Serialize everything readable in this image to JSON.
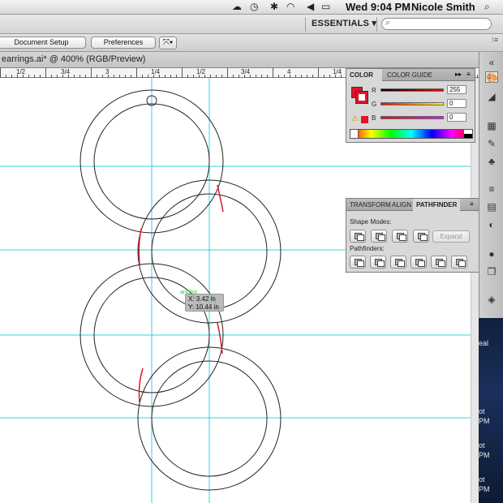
{
  "menubar": {
    "clock": "Wed 9:04 PM",
    "user": "Nicole Smith"
  },
  "topbar": {
    "workspace": "ESSENTIALS ▾"
  },
  "controlbar": {
    "document_setup": "Document Setup",
    "preferences": "Preferences"
  },
  "document": {
    "tab_title": "earrings.ai* @ 400% (RGB/Preview)"
  },
  "ruler": {
    "labels": [
      "1/2",
      "3/4",
      "3",
      "1/4",
      "1/2",
      "3/4",
      "4",
      "1/4"
    ]
  },
  "color_panel": {
    "tab_color": "COLOR",
    "tab_guide": "COLOR GUIDE",
    "r_label": "R",
    "g_label": "G",
    "b_label": "B",
    "r_value": "255",
    "g_value": "0",
    "b_value": "0"
  },
  "pathfinder_panel": {
    "tab_transform": "TRANSFORM",
    "tab_align": "ALIGN",
    "tab_pathfinder": "PATHFINDER",
    "shape_modes": "Shape Modes:",
    "pathfinders": "Pathfinders:",
    "expand": "Expand"
  },
  "tooltip": {
    "x": "X: 3.42 in",
    "y": "Y: 10.44 in"
  },
  "desktop": {
    "labels": [
      "eal",
      "ot",
      "PM",
      "ot",
      "PM",
      "ot",
      "PM"
    ]
  },
  "colors": {
    "guide": "#2fd3e6",
    "ring_stroke": "#222222",
    "selection_red": "#e0142a"
  }
}
